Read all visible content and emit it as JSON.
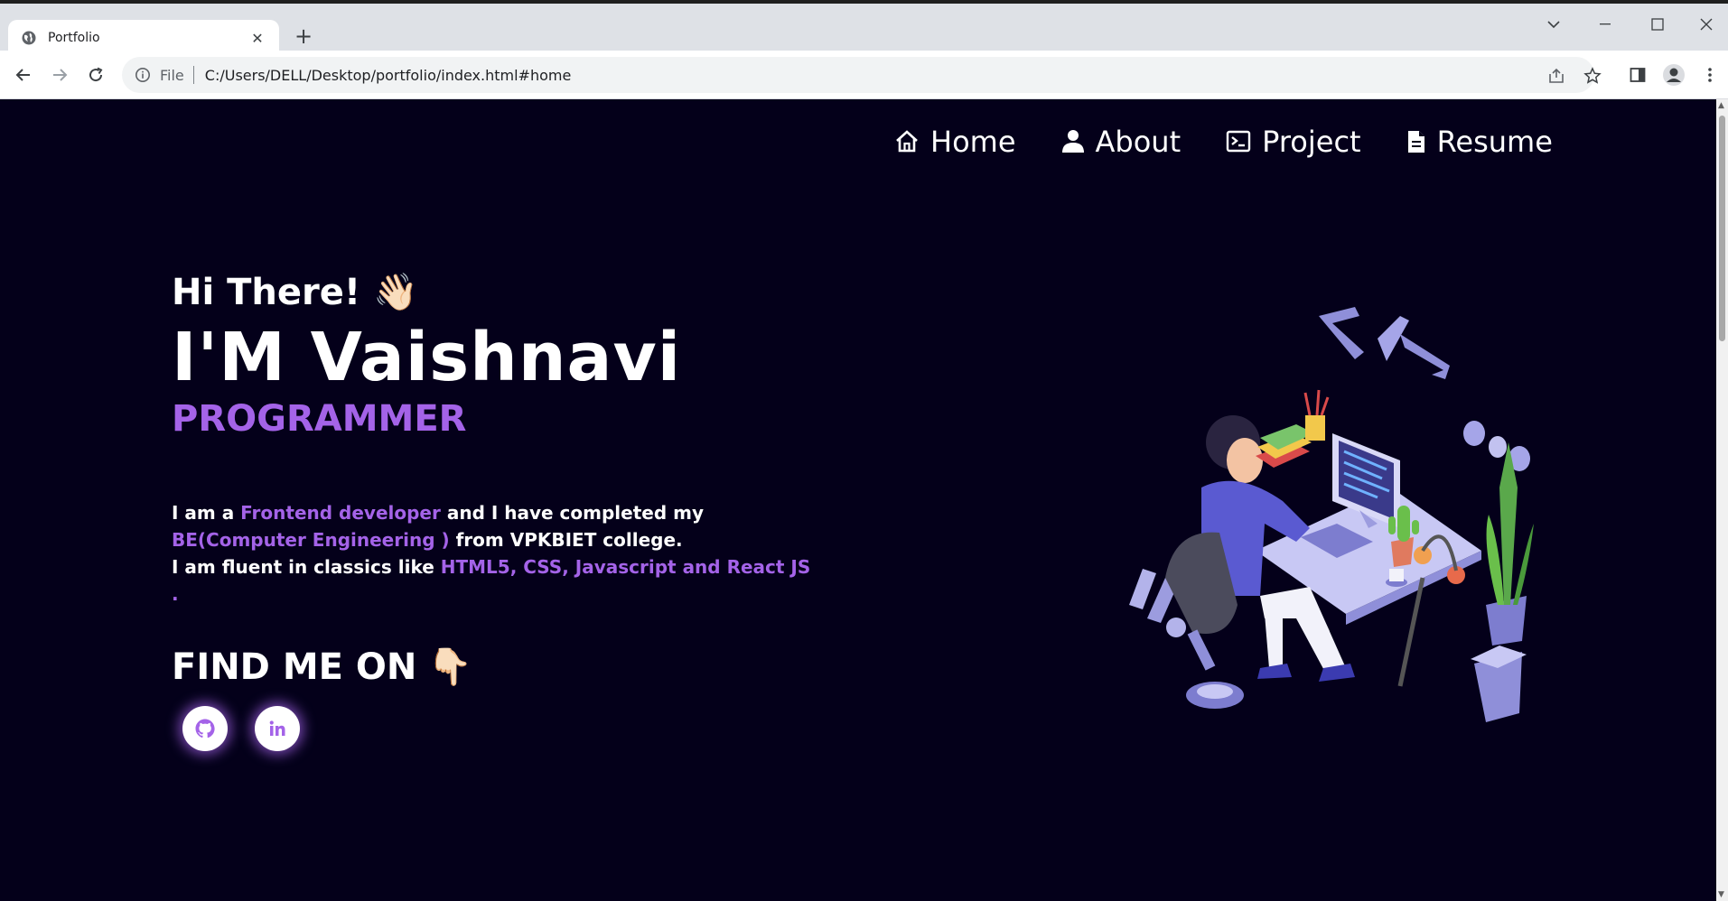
{
  "browser": {
    "tab_title": "Portfolio",
    "url_scheme": "File",
    "url": "C:/Users/DELL/Desktop/portfolio/index.html#home"
  },
  "page": {
    "nav": {
      "items": [
        {
          "label": "Home",
          "icon": "home-icon"
        },
        {
          "label": "About",
          "icon": "user-icon"
        },
        {
          "label": "Project",
          "icon": "terminal-icon"
        },
        {
          "label": "Resume",
          "icon": "document-icon"
        }
      ]
    },
    "hero": {
      "greeting": "Hi There!",
      "greeting_emoji": "👋🏻",
      "name": "I'M Vaishnavi",
      "role": "PROGRAMMER",
      "bio": {
        "t1": "I am a ",
        "h1": "Frontend developer",
        "t2": " and I have completed my ",
        "h2": "BE(Computer Engineering )",
        "t3": " from VPKBIET college.",
        "t4": "I am fluent in classics like ",
        "h3": "HTML5, CSS, Javascript and React JS ."
      },
      "find_me": "FIND ME ON",
      "find_emoji": "👇🏻",
      "socials": [
        {
          "name": "github-icon"
        },
        {
          "name": "linkedin-icon"
        }
      ]
    },
    "colors": {
      "background": "#04001a",
      "accent": "#a463e8",
      "text": "#ffffff"
    }
  }
}
